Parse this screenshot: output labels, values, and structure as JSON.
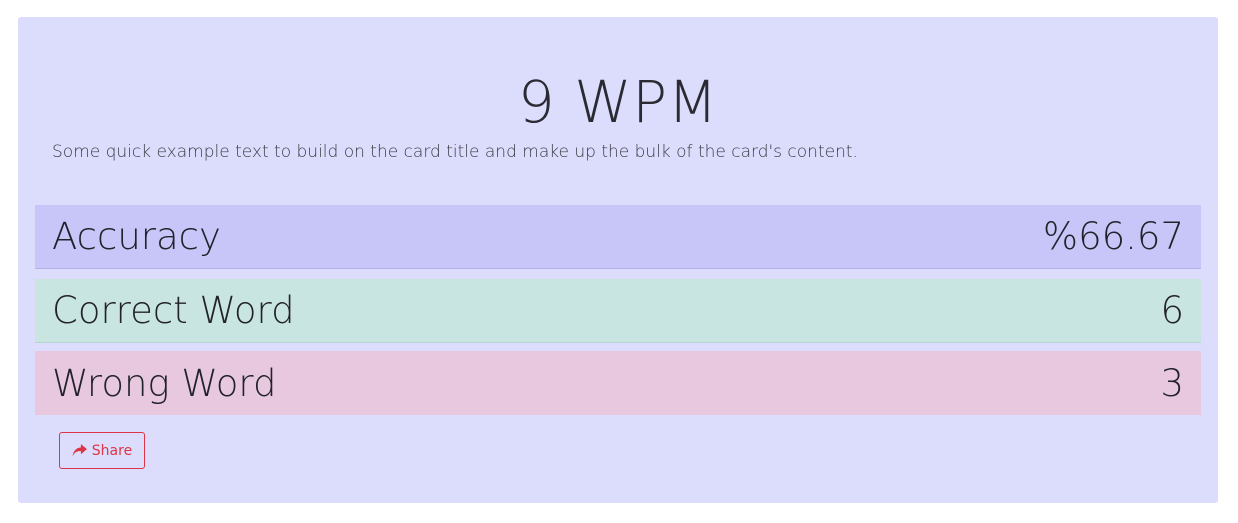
{
  "result": {
    "title": "9 WPM",
    "description": "Some quick example text to build on the card title and make up the bulk of the card's content."
  },
  "stats": [
    {
      "label": "Accuracy",
      "value": "%66.67",
      "color": "#c8c6f8"
    },
    {
      "label": "Correct Word",
      "value": "6",
      "color": "#c9e5e1"
    },
    {
      "label": "Wrong Word",
      "value": "3",
      "color": "#e8c8de"
    }
  ],
  "share": {
    "label": "Share",
    "icon": "share-icon",
    "color": "#dc3545"
  },
  "card": {
    "background": "#dcdcfc"
  }
}
